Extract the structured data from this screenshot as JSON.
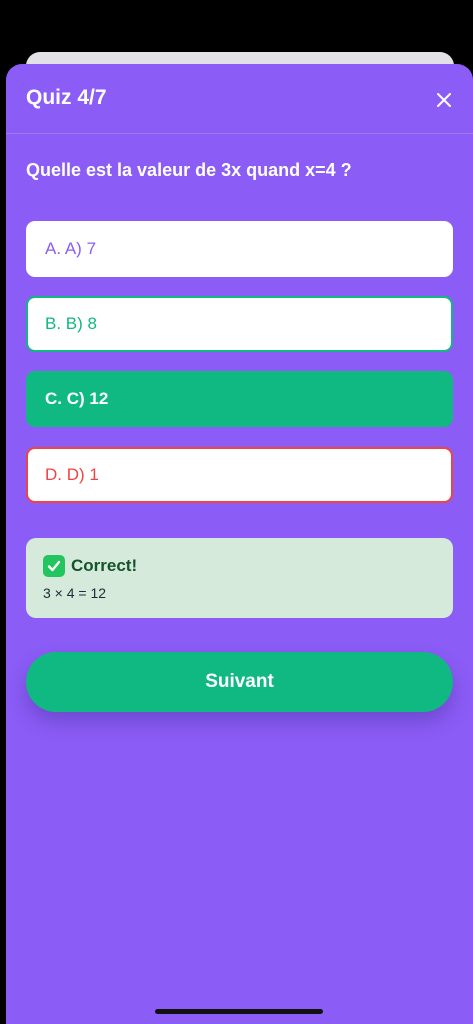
{
  "header": {
    "title": "Quiz 4/7",
    "close_icon": "close-icon"
  },
  "question": "Quelle est la valeur de 3x quand x=4 ?",
  "options": [
    {
      "label": "A. A) 7",
      "state": "default"
    },
    {
      "label": "B. B) 8",
      "state": "outlined-green"
    },
    {
      "label": "C. C) 12",
      "state": "correct-selected"
    },
    {
      "label": "D. D) 1",
      "state": "outlined-red"
    }
  ],
  "feedback": {
    "icon": "check-mark-icon",
    "title": "Correct!",
    "explanation": "3 × 4 = 12"
  },
  "next_button": {
    "label": "Suivant"
  },
  "colors": {
    "sheet": "#8b5cf6",
    "correct": "#10b981",
    "wrong": "#ef4444",
    "feedback_bg": "#d5eadb"
  }
}
